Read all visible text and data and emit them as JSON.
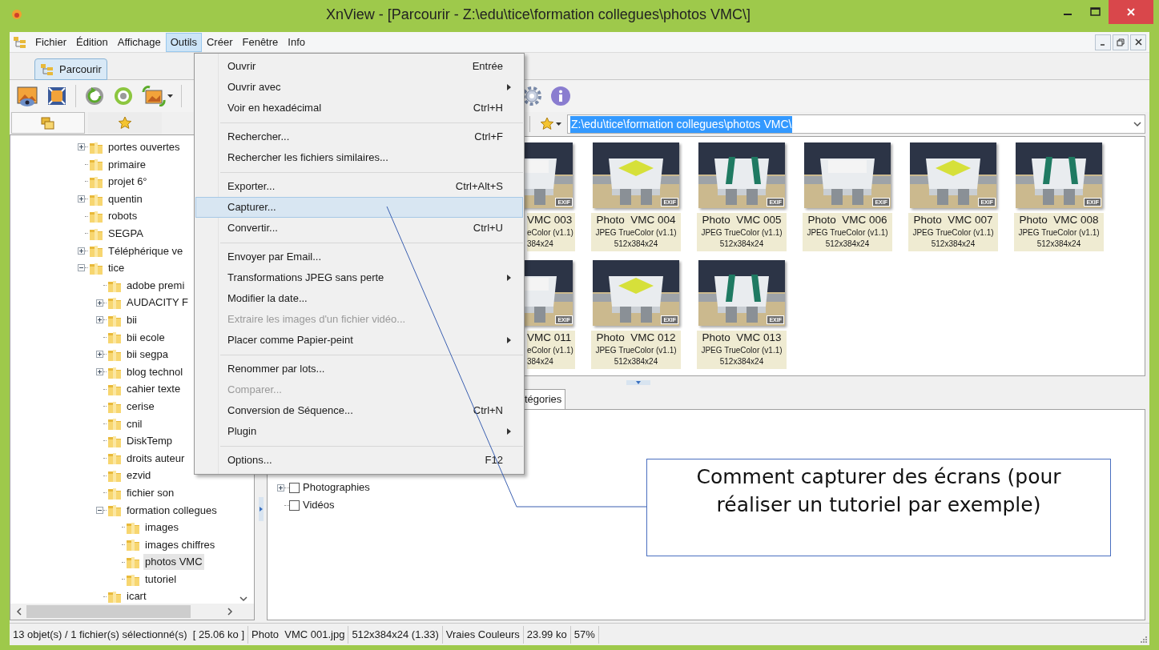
{
  "window": {
    "title": "XnView - [Parcourir - Z:\\edu\\tice\\formation collegues\\photos VMC\\]"
  },
  "menu_bar": [
    {
      "label": "Fichier",
      "selected": false
    },
    {
      "label": "Édition",
      "selected": false
    },
    {
      "label": "Affichage",
      "selected": false
    },
    {
      "label": "Outils",
      "selected": true
    },
    {
      "label": "Créer",
      "selected": false
    },
    {
      "label": "Fenêtre",
      "selected": false
    },
    {
      "label": "Info",
      "selected": false
    }
  ],
  "tabs": [
    {
      "label": "Parcourir",
      "selected": true
    }
  ],
  "panel_tabs": [
    {
      "selected": true
    },
    {
      "selected": false
    }
  ],
  "folder_tree": [
    {
      "label": "portes ouvertes",
      "expanded": false,
      "selected": false
    },
    {
      "label": "primaire",
      "selected": false
    },
    {
      "label": "projet 6°",
      "selected": false
    },
    {
      "label": "quentin",
      "expanded": false,
      "selected": false
    },
    {
      "label": "robots",
      "selected": false
    },
    {
      "label": "SEGPA",
      "selected": false
    },
    {
      "label": "Téléphérique ve",
      "expanded": false,
      "selected": false
    },
    {
      "label": "tice",
      "expanded": true,
      "selected": false,
      "children": [
        {
          "label": "adobe premi",
          "selected": false
        },
        {
          "label": "AUDACITY F",
          "expanded": false,
          "selected": false
        },
        {
          "label": "bii",
          "expanded": false,
          "selected": false
        },
        {
          "label": "bii ecole",
          "selected": false
        },
        {
          "label": "bii segpa",
          "expanded": false,
          "selected": false
        },
        {
          "label": "blog technol",
          "expanded": false,
          "selected": false
        },
        {
          "label": "cahier texte",
          "selected": false
        },
        {
          "label": "cerise",
          "selected": false
        },
        {
          "label": "cnil",
          "selected": false
        },
        {
          "label": "DiskTemp",
          "selected": false
        },
        {
          "label": "droits auteur",
          "selected": false
        },
        {
          "label": "ezvid",
          "selected": false
        },
        {
          "label": "fichier son",
          "selected": false
        },
        {
          "label": "formation collegues",
          "expanded": true,
          "selected": false,
          "children": [
            {
              "label": "images",
              "selected": false
            },
            {
              "label": "images chiffres",
              "selected": false
            },
            {
              "label": "photos VMC",
              "selected": true
            },
            {
              "label": "tutoriel",
              "selected": false
            }
          ]
        },
        {
          "label": "icart",
          "selected": false
        }
      ]
    }
  ],
  "address": {
    "value": "Z:\\edu\\tice\\formation collegues\\photos VMC\\"
  },
  "thumbnail_rows": [
    [
      {
        "kind": "cut",
        "name": "VMC 003",
        "format": "eColor (v1.1)",
        "size": "384x24",
        "badge": "EXIF"
      },
      {
        "kind": "full",
        "name": "Photo  VMC 004",
        "format": "JPEG TrueColor (v1.1)",
        "size": "512x384x24",
        "badge": "EXIF"
      },
      {
        "kind": "full",
        "name": "Photo  VMC 005",
        "format": "JPEG TrueColor (v1.1)",
        "size": "512x384x24",
        "badge": "EXIF"
      },
      {
        "kind": "full",
        "name": "Photo  VMC 006",
        "format": "JPEG TrueColor (v1.1)",
        "size": "512x384x24",
        "badge": "EXIF"
      },
      {
        "kind": "full",
        "name": "Photo  VMC 007",
        "format": "JPEG TrueColor (v1.1)",
        "size": "512x384x24",
        "badge": "EXIF"
      },
      {
        "kind": "full",
        "name": "Photo  VMC 008",
        "format": "JPEG TrueColor (v1.1)",
        "size": "512x384x24",
        "badge": "EXIF"
      }
    ],
    [
      {
        "kind": "cut",
        "name": "VMC 011",
        "format": "eColor (v1.1)",
        "size": "384x24",
        "badge": "EXIF"
      },
      {
        "kind": "full",
        "name": "Photo  VMC 012",
        "format": "JPEG TrueColor (v1.1)",
        "size": "512x384x24",
        "badge": "EXIF"
      },
      {
        "kind": "full",
        "name": "Photo  VMC 013",
        "format": "JPEG TrueColor (v1.1)",
        "size": "512x384x24",
        "badge": "EXIF"
      }
    ]
  ],
  "info_tabs": [
    {
      "label": "tégories",
      "selected": true
    }
  ],
  "categories": [
    {
      "label": "Photographies",
      "checked": false,
      "expanded": false
    },
    {
      "label": "Vidéos",
      "checked": false
    }
  ],
  "tools_menu": [
    {
      "kind": "item",
      "label": "Ouvrir",
      "shortcut": "Entrée",
      "submenu": false,
      "disabled": false,
      "selected": false
    },
    {
      "kind": "item",
      "label": "Ouvrir avec",
      "submenu": true,
      "disabled": false,
      "selected": false
    },
    {
      "kind": "item",
      "label": "Voir en hexadécimal",
      "shortcut": "Ctrl+H",
      "submenu": false,
      "disabled": false,
      "selected": false
    },
    {
      "kind": "separator"
    },
    {
      "kind": "item",
      "label": "Rechercher...",
      "shortcut": "Ctrl+F",
      "submenu": false,
      "disabled": false,
      "selected": false
    },
    {
      "kind": "item",
      "label": "Rechercher les fichiers similaires...",
      "submenu": false,
      "disabled": false,
      "selected": false
    },
    {
      "kind": "separator"
    },
    {
      "kind": "item",
      "label": "Exporter...",
      "shortcut": "Ctrl+Alt+S",
      "submenu": false,
      "disabled": false,
      "selected": false
    },
    {
      "kind": "item",
      "label": "Capturer...",
      "submenu": false,
      "disabled": false,
      "selected": true
    },
    {
      "kind": "item",
      "label": "Convertir...",
      "shortcut": "Ctrl+U",
      "submenu": false,
      "disabled": false,
      "selected": false
    },
    {
      "kind": "separator"
    },
    {
      "kind": "item",
      "label": "Envoyer par Email...",
      "submenu": false,
      "disabled": false,
      "selected": false
    },
    {
      "kind": "item",
      "label": "Transformations JPEG sans perte",
      "submenu": true,
      "disabled": false,
      "selected": false
    },
    {
      "kind": "item",
      "label": "Modifier la date...",
      "submenu": false,
      "disabled": false,
      "selected": false
    },
    {
      "kind": "item",
      "label": "Extraire les images d'un fichier vidéo...",
      "submenu": false,
      "disabled": true,
      "selected": false
    },
    {
      "kind": "item",
      "label": "Placer comme Papier-peint",
      "submenu": true,
      "disabled": false,
      "selected": false
    },
    {
      "kind": "separator"
    },
    {
      "kind": "item",
      "label": "Renommer par lots...",
      "submenu": false,
      "disabled": false,
      "selected": false
    },
    {
      "kind": "item",
      "label": "Comparer...",
      "submenu": false,
      "disabled": true,
      "selected": false
    },
    {
      "kind": "item",
      "label": "Conversion de Séquence...",
      "shortcut": "Ctrl+N",
      "submenu": false,
      "disabled": false,
      "selected": false
    },
    {
      "kind": "item",
      "label": "Plugin",
      "submenu": true,
      "disabled": false,
      "selected": false
    },
    {
      "kind": "separator"
    },
    {
      "kind": "item",
      "label": "Options...",
      "shortcut": "F12",
      "submenu": false,
      "disabled": false,
      "selected": false
    }
  ],
  "annotation": {
    "text": "Comment capturer des écrans (pour réaliser un tutoriel par exemple)"
  },
  "status_bar": [
    "13 objet(s) / 1 fichier(s) sélectionné(s)  [ 25.06 ko ]",
    "Photo  VMC 001.jpg",
    "512x384x24 (1.33)",
    "Vraies Couleurs",
    "23.99 ko",
    "57%"
  ]
}
